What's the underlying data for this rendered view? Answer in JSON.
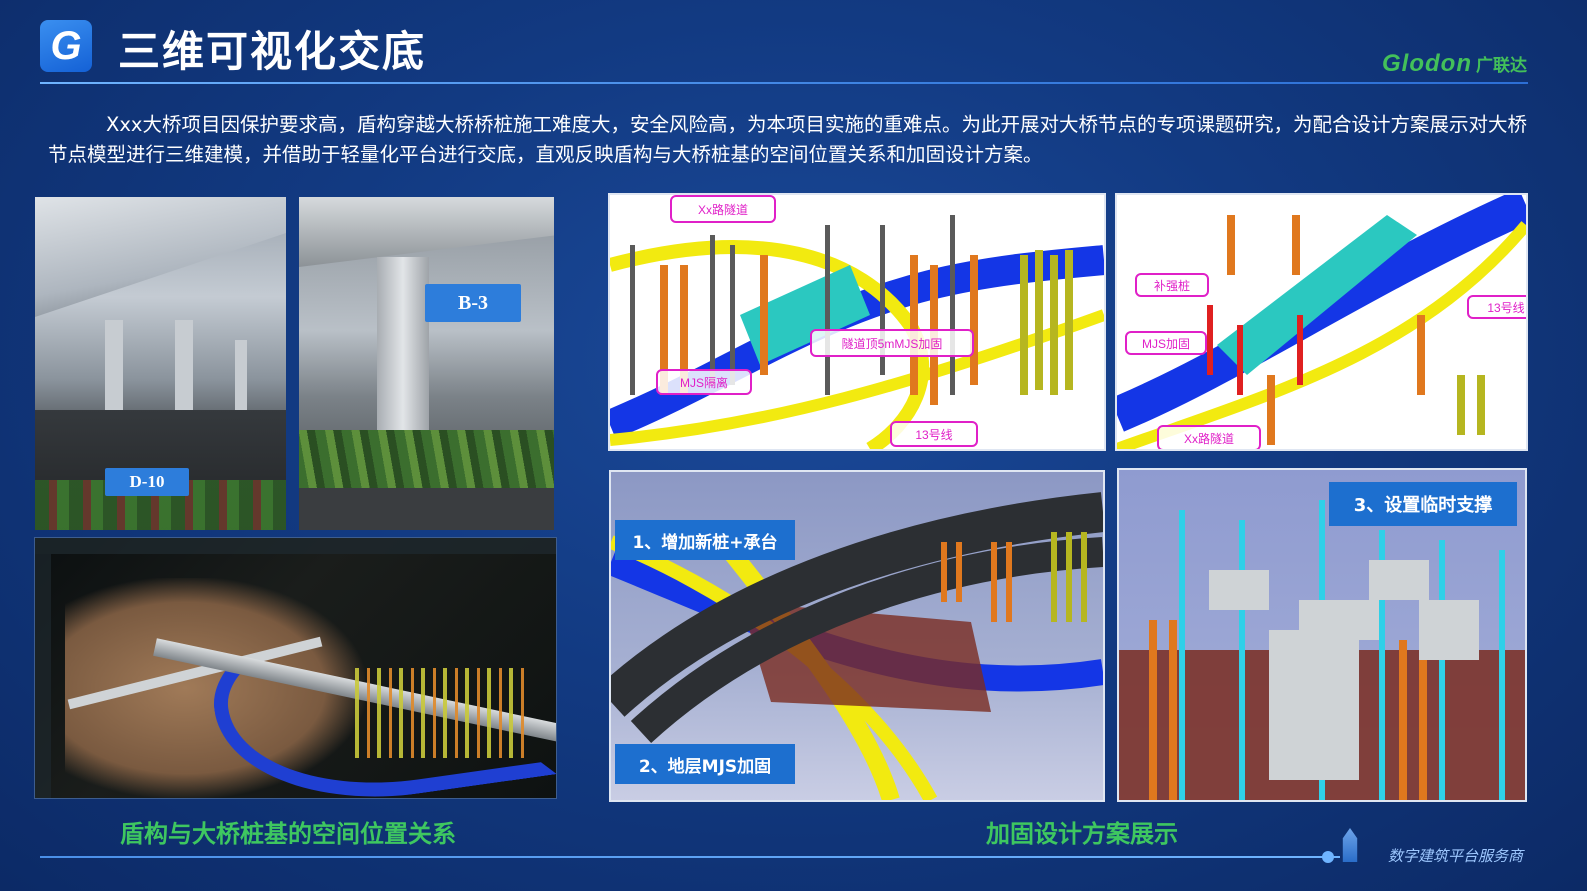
{
  "header": {
    "logo_letter": "G",
    "title": "三维可视化交底",
    "brand_name": "Glodon",
    "brand_cn": "广联达"
  },
  "intro": "Xxx大桥项目因保护要求高，盾构穿越大桥桥桩施工难度大，安全风险高，为本项目实施的重难点。为此开展对大桥节点的专项课题研究，为配合设计方案展示对大桥节点模型进行三维建模，并借助于轻量化平台进行交底，直观反映盾构与大桥桩基的空间位置关系和加固设计方案。",
  "photos": {
    "tag1": "D-10",
    "tag2": "B-3"
  },
  "model1": {
    "callout_tunnel": "Xx路隧道",
    "callout_reinforce": "隧道顶5mMJS加固",
    "callout_isolation": "MJS隔离",
    "callout_line": "13号线"
  },
  "model2": {
    "callout_pile": "补强桩",
    "callout_mjs": "MJS加固",
    "callout_line": "13号线",
    "callout_tunnel": "Xx路隧道"
  },
  "model3": {
    "label1": "1、增加新桩+承台",
    "label2": "2、地层MJS加固"
  },
  "model4": {
    "label3": "3、设置临时支撑"
  },
  "captions": {
    "left": "盾构与大桥桩基的空间位置关系",
    "right": "加固设计方案展示"
  },
  "footer": {
    "slogan": "数字建筑平台服务商"
  },
  "colors": {
    "background": "#123a82",
    "accent_blue": "#2d7ddb",
    "caption_green": "#3ec760",
    "callout_magenta": "#e020c8"
  }
}
